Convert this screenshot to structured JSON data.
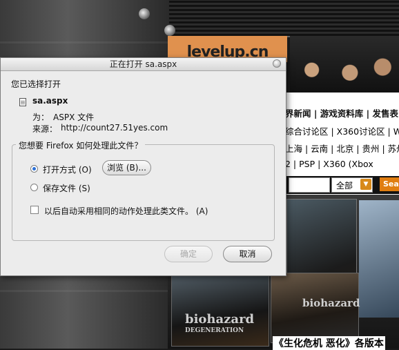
{
  "background_page": {
    "logo_text": "levelup.cn",
    "nav_row1": "界新闻 | 游戏资料库 | 发售表",
    "nav_row2": "综合讨论区 | X360讨论区 | W",
    "nav_row3": "上海 | 云南 | 北京 | 贵州 | 苏州 |",
    "nav_row4": "2  |  PSP  |  X360  (Xbox",
    "search_select_value": "全部",
    "search_button_label": "Sea",
    "caption": "《生化危机 恶化》各版本",
    "title_biohazard": "biohazard",
    "title_degeneration": "DEGENERATION"
  },
  "dialog": {
    "title": "正在打开 sa.aspx",
    "intro": "您已选择打开",
    "filename": "sa.aspx",
    "type_label": "为：",
    "type_value": "ASPX 文件",
    "source_label": "来源：",
    "source_value": "http://count27.51yes.com",
    "group_label": "您想要 Firefox 如何处理此文件？",
    "open_with_label": "打开方式 (O)",
    "browse_label": "浏览 (B)...",
    "save_label": "保存文件 (S)",
    "auto_label": "以后自动采用相同的动作处理此类文件。 (A)",
    "ok_label": "确定",
    "cancel_label": "取消",
    "open_with_selected": true,
    "save_selected": false,
    "auto_checked": false
  },
  "colors": {
    "radio_accent": "#2a6fd6",
    "page_orange": "#e07d10"
  }
}
